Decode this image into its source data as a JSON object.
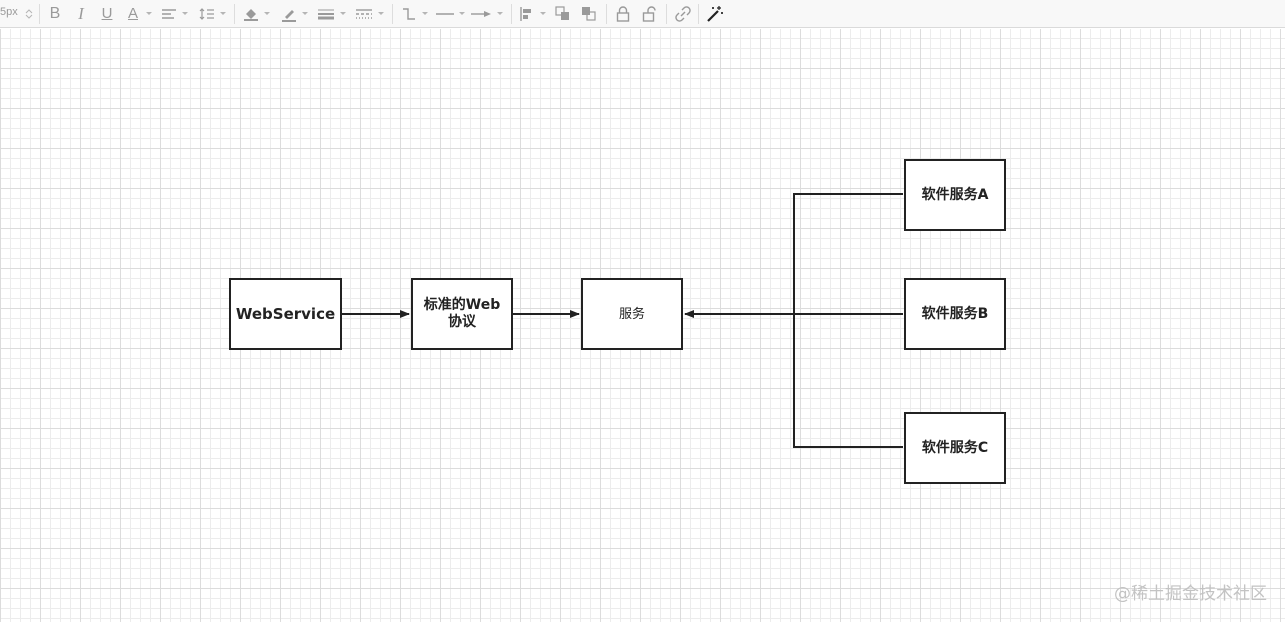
{
  "toolbar": {
    "font_size": "5px",
    "tools": [
      {
        "name": "bold",
        "glyph": "B"
      },
      {
        "name": "italic",
        "glyph": "I"
      },
      {
        "name": "underline",
        "glyph": "U"
      },
      {
        "name": "font-color",
        "glyph": "A"
      }
    ]
  },
  "diagram": {
    "nodes": {
      "webservice": "WebService",
      "protocol": "标准的Web\n协议",
      "service": "服务",
      "service_a": "软件服务A",
      "service_b": "软件服务B",
      "service_c": "软件服务C"
    }
  },
  "watermark": "@稀土掘金技术社区",
  "colors": {
    "stroke": "#222222",
    "grid_minor": "#ececec",
    "grid_major": "#dcdcdc",
    "toolbar_bg": "#f8f8f8",
    "icon": "#9a9a9a"
  }
}
